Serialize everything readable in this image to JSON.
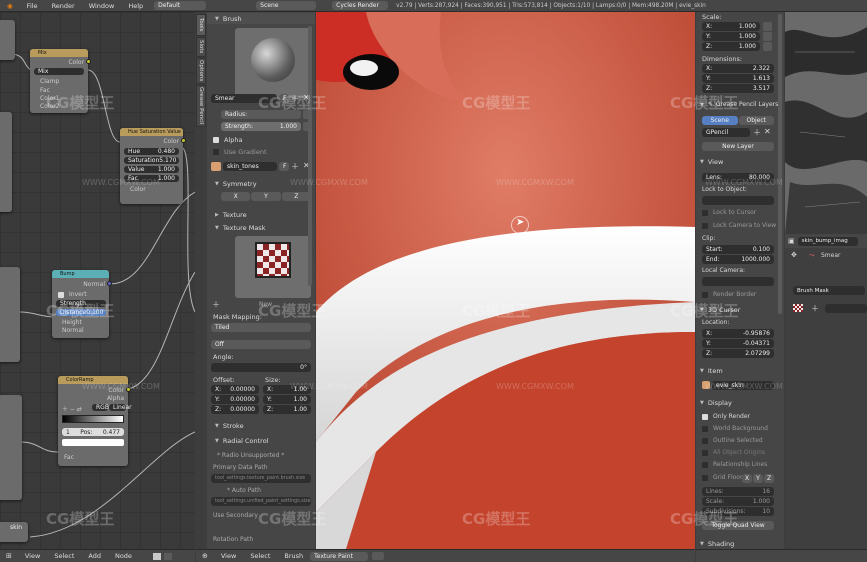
{
  "topbar": {
    "menus": [
      "File",
      "Render",
      "Window",
      "Help"
    ],
    "screen_layout": "Default",
    "scene": "Scene",
    "render_engine": "Cycles Render",
    "stats": "v2.79 | Verts:287,924 | Faces:390,951 | Tris:573,814 | Objects:1/10 | Lamps:0/0 | Mem:498.20M | evie_skin"
  },
  "nodes": {
    "mix": {
      "title": "Mix",
      "out": "Color",
      "blend": "Mix",
      "clamp": "Clamp",
      "fac": "Fac",
      "color1": "Color1",
      "color2": "Color2"
    },
    "hsv": {
      "title": "Hue Saturation Value",
      "out": "Color",
      "hue": "Hue",
      "hue_val": "0.480",
      "sat": "Saturation",
      "sat_val": "5.170",
      "value": "Value",
      "value_val": "1.000",
      "fac": "Fac",
      "fac_val": "1.000",
      "color": "Color"
    },
    "bump": {
      "title": "Bump",
      "out": "Normal",
      "invert": "Invert",
      "strength": "Strength",
      "distance": "Distance",
      "distance_val": "0.100",
      "height": "Height",
      "normal": "Normal"
    },
    "colorramp": {
      "title": "ColorRamp",
      "out_color": "Color",
      "out_alpha": "Alpha",
      "mode": "RGB",
      "interp": "Linear",
      "index": "1",
      "pos": "Pos:",
      "pos_val": "0.477",
      "fac": "Fac"
    },
    "skin": "skin"
  },
  "tool_tabs": [
    "Tools",
    "Slots",
    "Options",
    "Grease Pencil"
  ],
  "tools": {
    "brush_header": "Brush",
    "brush_name": "Smear",
    "brush_users": "F",
    "radius": "Radius:",
    "radius_val": "",
    "strength": "Strength:",
    "strength_val": "1.000",
    "alpha": "Alpha",
    "use_gradient": "Use Gradient",
    "palette": "skin_tones",
    "symmetry_header": "Symmetry",
    "sym_axes": [
      "X",
      "Y",
      "Z"
    ],
    "texture_header": "Texture",
    "texture_mask_header": "Texture Mask",
    "mask_name": "New",
    "mask_mapping": "Mask Mapping:",
    "mask_mapping_val": "Tiled",
    "off": "Off",
    "angle": "Angle:",
    "angle_val": "0°",
    "offset": "Offset:",
    "size": "Size:",
    "offset_vals": [
      {
        "axis": "X:",
        "val": "0.00000"
      },
      {
        "axis": "Y:",
        "val": "0.00000"
      },
      {
        "axis": "Z:",
        "val": "0.00000"
      }
    ],
    "size_vals": [
      {
        "axis": "X:",
        "val": "1.00"
      },
      {
        "axis": "Y:",
        "val": "1.00"
      },
      {
        "axis": "Z:",
        "val": "1.00"
      }
    ],
    "stroke_header": "Stroke",
    "radial_header": "Radial Control",
    "radial_unsupported": "* Radio Unsupported *",
    "primary_data_path": "Primary Data Path",
    "primary_path_val": "tool_settings.texture_paint.brush.size",
    "alt_path": "* Auto Path",
    "alt_path_val": "tool_settings.unified_paint_settings.size",
    "use_secondary": "Use Secondary",
    "rotation_path": "Rotation Path"
  },
  "props": {
    "scale": "Scale:",
    "scale_vals": [
      {
        "axis": "X:",
        "val": "1.000"
      },
      {
        "axis": "Y:",
        "val": "1.000"
      },
      {
        "axis": "Z:",
        "val": "1.000"
      }
    ],
    "dimensions": "Dimensions:",
    "dim_vals": [
      {
        "axis": "X:",
        "val": "2.322"
      },
      {
        "axis": "Y:",
        "val": "1.613"
      },
      {
        "axis": "Z:",
        "val": "3.517"
      }
    ],
    "grease_header": "Grease Pencil Layers",
    "scene_tab": "Scene",
    "object_tab": "Object",
    "gpencil": "GPencil",
    "new_layer": "New Layer",
    "view_header": "View",
    "lens": "Lens:",
    "lens_val": "80.000",
    "lock_to_object": "Lock to Object:",
    "lock_to_cursor": "Lock to Cursor",
    "lock_camera": "Lock Camera to View",
    "clip": "Clip:",
    "clip_start": "Start:",
    "clip_start_val": "0.100",
    "clip_end": "End:",
    "clip_end_val": "1000.000",
    "local_camera": "Local Camera:",
    "render_border": "Render Border",
    "cursor_header": "3D Cursor",
    "location": "Location:",
    "loc_vals": [
      {
        "axis": "X:",
        "val": "-0.95876"
      },
      {
        "axis": "Y:",
        "val": "-0.04371"
      },
      {
        "axis": "Z:",
        "val": "2.07299"
      }
    ],
    "item_header": "Item",
    "item_name": "evie_skin",
    "display_header": "Display",
    "only_render": "Only Render",
    "world_background": "World Background",
    "outline_selected": "Outline Selected",
    "all_object_origins": "All Object Origins",
    "relationship_lines": "Relationship Lines",
    "grid_floor": "Grid Floor",
    "grid_axes": [
      "X",
      "Y",
      "Z"
    ],
    "lines": "Lines:",
    "lines_val": "16",
    "scale_lbl": "Scale:",
    "scale_lbl_val": "1.000",
    "subdivisions": "Subdivisions:",
    "subdivisions_val": "10",
    "toggle_quad": "Toggle Quad View",
    "shading_header": "Shading"
  },
  "image_editor": {
    "image_name": "skin_bump_imag",
    "brush": "Smear",
    "brush_mask": "Brush Mask"
  },
  "bottom": {
    "node_menus": [
      "View",
      "Select",
      "Add",
      "Node"
    ],
    "view_menus": [
      "View",
      "Select",
      "Brush"
    ],
    "mode": "Texture Paint"
  },
  "watermark": {
    "brand": "CG模型王",
    "url": "WWW.CGMXW.COM"
  }
}
